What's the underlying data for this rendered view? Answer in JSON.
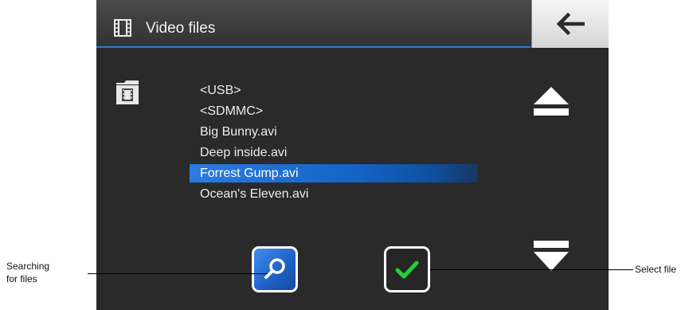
{
  "header": {
    "title": "Video files",
    "title_icon": "film-strip-icon",
    "back_icon": "back-arrow-icon"
  },
  "sidebar": {
    "folder_icon": "film-folder-icon"
  },
  "file_list": {
    "items": [
      {
        "label": "<USB>",
        "selected": false
      },
      {
        "label": "<SDMMC>",
        "selected": false
      },
      {
        "label": "Big Bunny.avi",
        "selected": false
      },
      {
        "label": "Deep inside.avi",
        "selected": false
      },
      {
        "label": "Forrest Gump.avi",
        "selected": true
      },
      {
        "label": "Ocean's Eleven.avi",
        "selected": false
      }
    ]
  },
  "controls": {
    "scroll_up_icon": "eject-up-icon",
    "scroll_down_icon": "eject-down-icon",
    "search_icon": "magnifier-icon",
    "select_icon": "checkmark-icon"
  },
  "annotations": {
    "search_line1": "Searching",
    "search_line2": "for files",
    "select": "Select file"
  },
  "colors": {
    "accent": "#2d7bd0",
    "selection": "#1565c8",
    "check": "#1fd13a",
    "background": "#2a2a2a"
  }
}
